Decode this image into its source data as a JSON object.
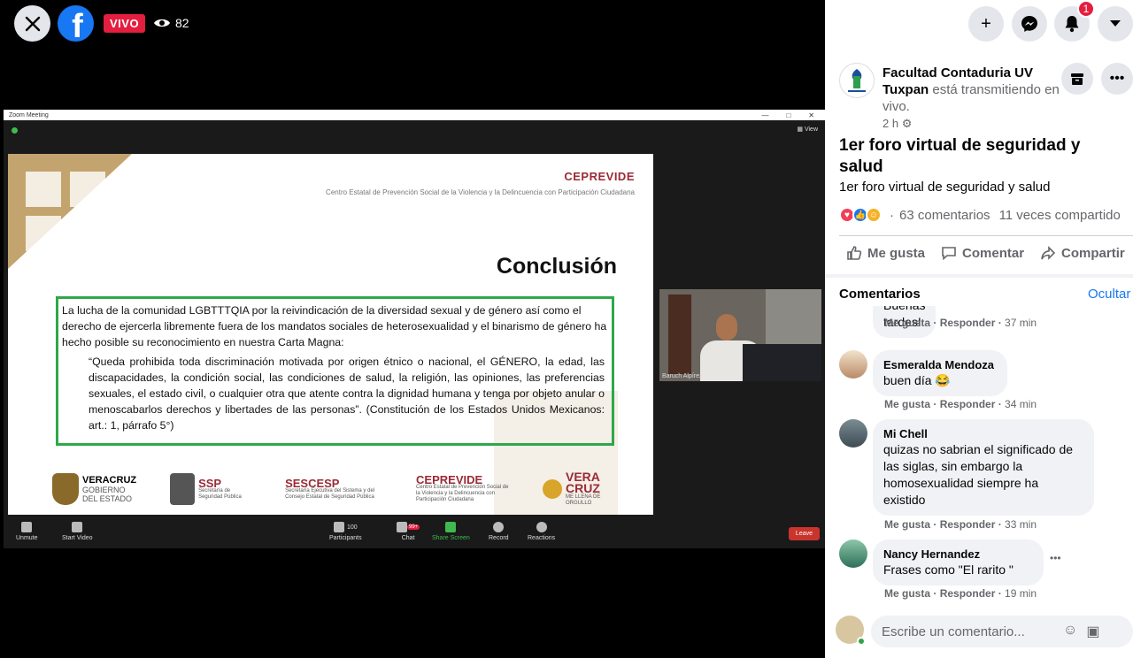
{
  "live": {
    "badge": "VIVO",
    "viewers": "82"
  },
  "zoom": {
    "title": "Zoom Meeting",
    "view": "View",
    "participant": "Baruch Alpírez",
    "toolbar": {
      "unmute": "Unmute",
      "start_video": "Start Video",
      "participants": "Participants",
      "participants_count": "100",
      "chat": "Chat",
      "chat_badge": "99+",
      "share": "Share Screen",
      "record": "Record",
      "reactions": "Reactions",
      "leave": "Leave"
    }
  },
  "slide": {
    "org": "CEPREVIDE",
    "org_full": "Centro Estatal de Prevención Social de la Violencia y la Delincuencia con Participación Ciudadana",
    "title": "Conclusión",
    "intro": "La lucha de la comunidad LGBTTTQIA por la reivindicación de la diversidad sexual y de género así como el derecho de ejercerla libremente fuera de los mandatos sociales de heterosexualidad y el binarismo de género ha hecho posible su reconocimiento en nuestra Carta Magna:",
    "quote": "“Queda prohibida toda discriminación motivada por origen étnico o nacional, el GÉNERO, la edad, las discapacidades, la condición social, las condiciones de salud, la religión, las opiniones, las preferencias sexuales, el estado civil, o cualquier otra que atente contra la dignidad humana y tenga por objeto anular o menoscabarlos derechos y libertades de las personas”. (Constitución de los Estados Unidos Mexicanos: art.: 1, párrafo 5°)",
    "logos": [
      {
        "main": "VERACRUZ",
        "sub": "GOBIERNO DEL ESTADO"
      },
      {
        "main": "SSP",
        "sub": "Secretaría de Seguridad Pública"
      },
      {
        "main": "SESCESP",
        "sub": "Secretaría Ejecutiva del Sistema y del Consejo Estatal de Seguridad Pública"
      },
      {
        "main": "CEPREVIDE",
        "sub": "Centro Estatal de Prevención Social de la Violencia y la Delincuencia con Participación Ciudadana"
      },
      {
        "main": "VERA CRUZ",
        "sub": "ME LLENA DE ORGULLO"
      }
    ]
  },
  "notifications": {
    "count": "1"
  },
  "post": {
    "page_name": "Facultad Contaduria UV Tuxpan",
    "action": " está transmitiendo en vivo.",
    "time": "2 h",
    "title": "1er foro virtual de seguridad y salud",
    "description": "1er foro virtual de seguridad y salud",
    "comments_count": "63 comentarios",
    "shares": "11 veces compartido"
  },
  "actions": {
    "like": "Me gusta",
    "comment": "Comentar",
    "share": "Compartir"
  },
  "comments_header": {
    "label": "Comentarios",
    "hide": "Ocultar"
  },
  "comments": [
    {
      "text": "Buenas tardes!",
      "like": "Me gusta",
      "reply": "Responder",
      "time": "37 min"
    },
    {
      "name": "Esmeralda Mendoza",
      "text": "buen día 😂",
      "like": "Me gusta",
      "reply": "Responder",
      "time": "34 min"
    },
    {
      "name": "Mi Chell",
      "text": "quizas no sabrian el significado de las siglas, sin embargo la homosexualidad siempre ha existido",
      "like": "Me gusta",
      "reply": "Responder",
      "time": "33 min"
    },
    {
      "name": "Nancy Hernandez",
      "text": "Frases como \"El rarito \"",
      "like": "Me gusta",
      "reply": "Responder",
      "time": "19 min"
    }
  ],
  "comment_input": {
    "placeholder": "Escribe un comentario..."
  },
  "colors": {
    "facebook_blue": "#1877f2",
    "live_red": "#e41e3f",
    "slide_green": "#2ea84a",
    "cepre_red": "#9a2a36"
  }
}
